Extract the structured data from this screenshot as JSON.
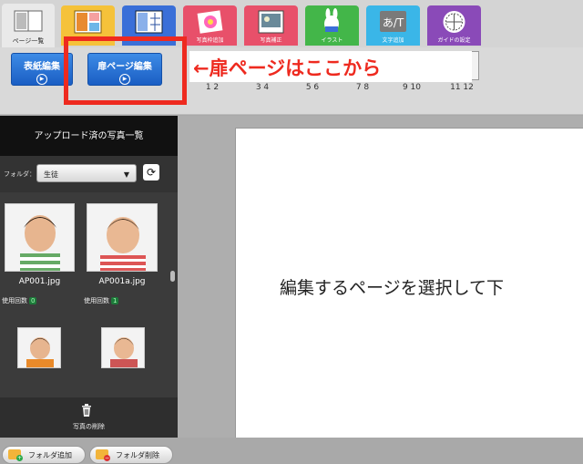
{
  "top_tabs": [
    {
      "label": "ページ一覧",
      "icon": "page-list-icon",
      "color": "#e9e9e9"
    },
    {
      "label": "",
      "icon": "layout-icon",
      "color": "#f5c23a"
    },
    {
      "label": "",
      "icon": "grid-icon",
      "color": "#3a6fd8"
    },
    {
      "label": "写真枠追加",
      "icon": "photo-frame-icon",
      "color": "#e8506a"
    },
    {
      "label": "写真補正",
      "icon": "photo-correct-icon",
      "color": "#e8506a"
    },
    {
      "label": "イラスト",
      "icon": "illustration-icon",
      "color": "#43b649"
    },
    {
      "label": "文字追加",
      "icon": "text-add-icon",
      "color": "#3ab6e8"
    },
    {
      "label": "ガイドの設定",
      "icon": "guide-icon",
      "color": "#8a4ab8"
    }
  ],
  "page_buttons": {
    "cover_label": "表紙編集",
    "door_label": "扉ページ編集"
  },
  "callout": {
    "text": "←扉ページはここから"
  },
  "spreads": [
    "1 2",
    "3 4",
    "5 6",
    "7 8",
    "9 10",
    "11 12"
  ],
  "left_panel": {
    "title": "アップロード済の写真一覧",
    "folder_label": "フォルダ：",
    "folder_value": "生徒",
    "photos": [
      {
        "name": "AP001.jpg",
        "use_label": "使用回数",
        "count": "0"
      },
      {
        "name": "AP001a.jpg",
        "use_label": "使用回数",
        "count": "1"
      }
    ],
    "add_folder_label": "フォルダ追加",
    "delete_folder_label": "フォルダ削除",
    "delete_photo_label": "写真の削除"
  },
  "canvas": {
    "instruction": "編集するページを選択して下"
  }
}
